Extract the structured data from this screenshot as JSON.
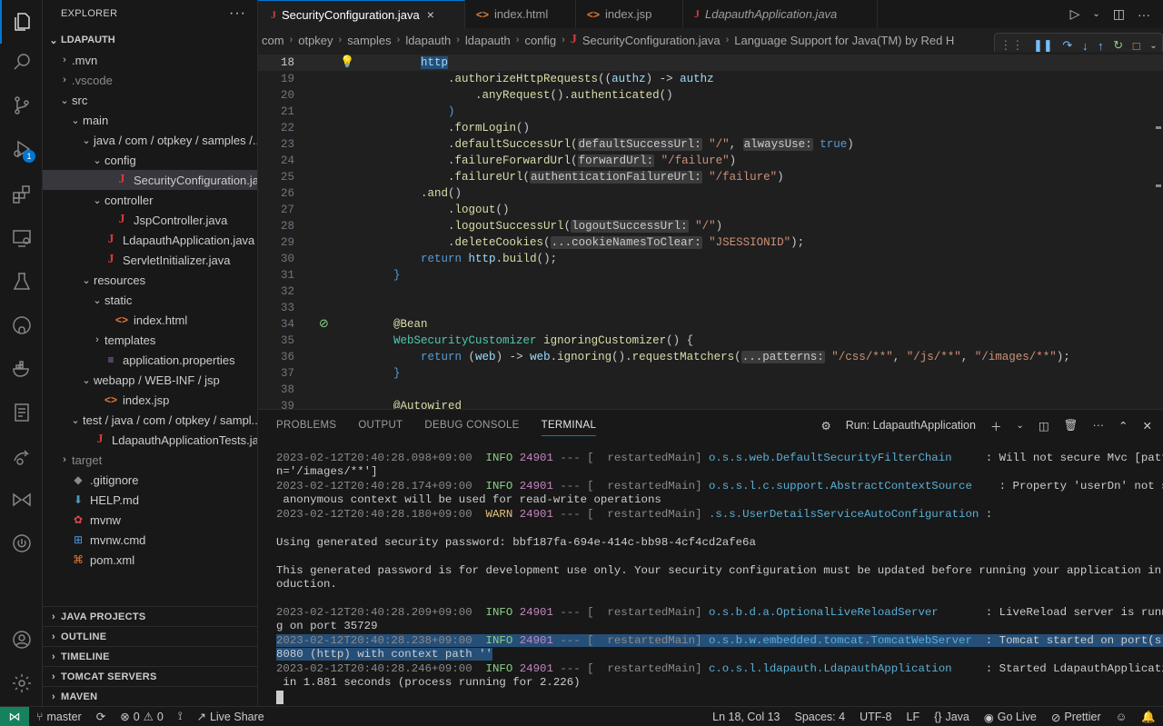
{
  "sidebar": {
    "title": "EXPLORER",
    "more": "···",
    "root": "LDAPAUTH",
    "tree": [
      {
        "depth": 1,
        "chev": "›",
        "icon": "",
        "label": ".mvn",
        "dim": false
      },
      {
        "depth": 1,
        "chev": "›",
        "icon": "",
        "label": ".vscode",
        "dim": true
      },
      {
        "depth": 1,
        "chev": "⌄",
        "icon": "",
        "label": "src",
        "dim": false
      },
      {
        "depth": 2,
        "chev": "⌄",
        "icon": "",
        "label": "main",
        "dim": false
      },
      {
        "depth": 3,
        "chev": "⌄",
        "icon": "",
        "label": "java / com / otpkey / samples /...",
        "dim": false
      },
      {
        "depth": 4,
        "chev": "⌄",
        "icon": "",
        "label": "config",
        "dim": false
      },
      {
        "depth": 5,
        "chev": "",
        "icon": "J",
        "label": "SecurityConfiguration.java",
        "dim": false,
        "selected": true
      },
      {
        "depth": 4,
        "chev": "⌄",
        "icon": "",
        "label": "controller",
        "dim": false
      },
      {
        "depth": 5,
        "chev": "",
        "icon": "J",
        "label": "JspController.java",
        "dim": false
      },
      {
        "depth": 4,
        "chev": "",
        "icon": "J",
        "label": "LdapauthApplication.java",
        "dim": false
      },
      {
        "depth": 4,
        "chev": "",
        "icon": "J",
        "label": "ServletInitializer.java",
        "dim": false
      },
      {
        "depth": 3,
        "chev": "⌄",
        "icon": "",
        "label": "resources",
        "dim": false
      },
      {
        "depth": 4,
        "chev": "⌄",
        "icon": "",
        "label": "static",
        "dim": false
      },
      {
        "depth": 5,
        "chev": "",
        "icon": "<>",
        "label": "index.html",
        "dim": false
      },
      {
        "depth": 4,
        "chev": "›",
        "icon": "",
        "label": "templates",
        "dim": false
      },
      {
        "depth": 4,
        "chev": "",
        "icon": "≡",
        "label": "application.properties",
        "dim": false
      },
      {
        "depth": 3,
        "chev": "⌄",
        "icon": "",
        "label": "webapp / WEB-INF / jsp",
        "dim": false
      },
      {
        "depth": 4,
        "chev": "",
        "icon": "<>",
        "label": "index.jsp",
        "dim": false
      },
      {
        "depth": 2,
        "chev": "⌄",
        "icon": "",
        "label": "test / java / com / otpkey / sampl...",
        "dim": false
      },
      {
        "depth": 3,
        "chev": "",
        "icon": "J",
        "label": "LdapauthApplicationTests.java",
        "dim": false
      },
      {
        "depth": 1,
        "chev": "›",
        "icon": "",
        "label": "target",
        "dim": true
      },
      {
        "depth": 1,
        "chev": "",
        "icon": "◆",
        "label": ".gitignore",
        "dim": false
      },
      {
        "depth": 1,
        "chev": "",
        "icon": "⬇",
        "label": "HELP.md",
        "dim": false
      },
      {
        "depth": 1,
        "chev": "",
        "icon": "✿",
        "label": "mvnw",
        "dim": false
      },
      {
        "depth": 1,
        "chev": "",
        "icon": "⊞",
        "label": "mvnw.cmd",
        "dim": false
      },
      {
        "depth": 1,
        "chev": "",
        "icon": "⌘",
        "label": "pom.xml",
        "dim": false
      }
    ],
    "sections": [
      "JAVA PROJECTS",
      "OUTLINE",
      "TIMELINE",
      "TOMCAT SERVERS",
      "MAVEN"
    ]
  },
  "tabs": [
    {
      "label": "SecurityConfiguration.java",
      "icon": "J",
      "active": true,
      "close": "×"
    },
    {
      "label": "index.html",
      "icon": "<>",
      "active": false
    },
    {
      "label": "index.jsp",
      "icon": "<>",
      "active": false
    },
    {
      "label": "LdapauthApplication.java",
      "icon": "J",
      "active": false,
      "italic": true
    }
  ],
  "breadcrumb": [
    "com",
    "otpkey",
    "samples",
    "ldapauth",
    "ldapauth",
    "config",
    "SecurityConfiguration.java",
    "Language Support for Java(TM) by Red H"
  ],
  "editor": {
    "lines": [
      {
        "n": "18",
        "current": true,
        "glyph": "bulb",
        "code": [
          [
            "        ",
            "p"
          ],
          [
            "http",
            "v hl"
          ]
        ]
      },
      {
        "n": "19",
        "code": [
          [
            "            .",
            "p"
          ],
          [
            "authorizeHttpRequests",
            "m"
          ],
          [
            "((",
            "p"
          ],
          [
            "authz",
            "v"
          ],
          [
            ") -> ",
            "p"
          ],
          [
            "authz",
            "v"
          ]
        ]
      },
      {
        "n": "20",
        "code": [
          [
            "                .",
            "p"
          ],
          [
            "anyRequest",
            "m"
          ],
          [
            "().",
            "p"
          ],
          [
            "authenticated",
            "m"
          ],
          [
            "()",
            "p"
          ]
        ]
      },
      {
        "n": "21",
        "code": [
          [
            "            )",
            "k"
          ]
        ]
      },
      {
        "n": "22",
        "code": [
          [
            "            .",
            "p"
          ],
          [
            "formLogin",
            "m"
          ],
          [
            "()",
            "p"
          ]
        ]
      },
      {
        "n": "23",
        "code": [
          [
            "            .",
            "p"
          ],
          [
            "defaultSuccessUrl",
            "m"
          ],
          [
            "(",
            "p"
          ],
          [
            "defaultSuccessUrl:",
            "ph"
          ],
          [
            " ",
            "p"
          ],
          [
            "\"/\"",
            "s"
          ],
          [
            ", ",
            "p"
          ],
          [
            "alwaysUse:",
            "ph"
          ],
          [
            " ",
            "p"
          ],
          [
            "true",
            "k"
          ],
          [
            ")",
            "p"
          ]
        ]
      },
      {
        "n": "24",
        "code": [
          [
            "            .",
            "p"
          ],
          [
            "failureForwardUrl",
            "m"
          ],
          [
            "(",
            "p"
          ],
          [
            "forwardUrl:",
            "ph"
          ],
          [
            " ",
            "p"
          ],
          [
            "\"/failure\"",
            "s"
          ],
          [
            ")",
            "p"
          ]
        ]
      },
      {
        "n": "25",
        "code": [
          [
            "            .",
            "p"
          ],
          [
            "failureUrl",
            "m"
          ],
          [
            "(",
            "p"
          ],
          [
            "authenticationFailureUrl:",
            "ph"
          ],
          [
            " ",
            "p"
          ],
          [
            "\"/failure\"",
            "s"
          ],
          [
            ")",
            "p"
          ]
        ]
      },
      {
        "n": "26",
        "code": [
          [
            "        .",
            "p"
          ],
          [
            "and",
            "m"
          ],
          [
            "()",
            "p"
          ]
        ]
      },
      {
        "n": "27",
        "code": [
          [
            "            .",
            "p"
          ],
          [
            "logout",
            "m"
          ],
          [
            "()",
            "p"
          ]
        ]
      },
      {
        "n": "28",
        "code": [
          [
            "            .",
            "p"
          ],
          [
            "logoutSuccessUrl",
            "m"
          ],
          [
            "(",
            "p"
          ],
          [
            "logoutSuccessUrl:",
            "ph"
          ],
          [
            " ",
            "p"
          ],
          [
            "\"/\"",
            "s"
          ],
          [
            ")",
            "p"
          ]
        ]
      },
      {
        "n": "29",
        "code": [
          [
            "            .",
            "p"
          ],
          [
            "deleteCookies",
            "m"
          ],
          [
            "(",
            "p"
          ],
          [
            "...cookieNamesToClear:",
            "ph"
          ],
          [
            " ",
            "p"
          ],
          [
            "\"JSESSIONID\"",
            "s"
          ],
          [
            ");",
            "p"
          ]
        ]
      },
      {
        "n": "30",
        "code": [
          [
            "        ",
            "p"
          ],
          [
            "return",
            "k"
          ],
          [
            " ",
            "p"
          ],
          [
            "http",
            "v"
          ],
          [
            ".",
            "p"
          ],
          [
            "build",
            "m"
          ],
          [
            "();",
            "p"
          ]
        ]
      },
      {
        "n": "31",
        "code": [
          [
            "    }",
            "k"
          ]
        ]
      },
      {
        "n": "32",
        "code": []
      },
      {
        "n": "33",
        "code": []
      },
      {
        "n": "34",
        "glyph": "noentry",
        "code": [
          [
            "    ",
            "p"
          ],
          [
            "@Bean",
            "a"
          ]
        ]
      },
      {
        "n": "35",
        "code": [
          [
            "    ",
            "p"
          ],
          [
            "WebSecurityCustomizer",
            "t"
          ],
          [
            " ",
            "p"
          ],
          [
            "ignoringCustomizer",
            "m"
          ],
          [
            "() {",
            "p"
          ]
        ]
      },
      {
        "n": "36",
        "code": [
          [
            "        ",
            "p"
          ],
          [
            "return",
            "k"
          ],
          [
            " (",
            "p"
          ],
          [
            "web",
            "v"
          ],
          [
            ") -> ",
            "p"
          ],
          [
            "web",
            "v"
          ],
          [
            ".",
            "p"
          ],
          [
            "ignoring",
            "m"
          ],
          [
            "().",
            "p"
          ],
          [
            "requestMatchers",
            "m"
          ],
          [
            "(",
            "p"
          ],
          [
            "...patterns:",
            "ph"
          ],
          [
            " ",
            "p"
          ],
          [
            "\"/css/**\"",
            "s"
          ],
          [
            ", ",
            "p"
          ],
          [
            "\"/js/**\"",
            "s"
          ],
          [
            ", ",
            "p"
          ],
          [
            "\"/images/**\"",
            "s"
          ],
          [
            ");",
            "p"
          ]
        ]
      },
      {
        "n": "37",
        "code": [
          [
            "    }",
            "k"
          ]
        ]
      },
      {
        "n": "38",
        "code": []
      },
      {
        "n": "39",
        "code": [
          [
            "    ",
            "p"
          ],
          [
            "@Autowired",
            "a"
          ]
        ]
      }
    ]
  },
  "panel": {
    "tabs": [
      "PROBLEMS",
      "OUTPUT",
      "DEBUG CONSOLE",
      "TERMINAL"
    ],
    "active_tab": "TERMINAL",
    "run_label": "Run: LdapauthApplication",
    "terminal": [
      {
        "segs": [
          [
            "2023-02-12T20:40:28.098+09:00  ",
            "ts"
          ],
          [
            "INFO",
            "tinfo"
          ],
          [
            " ",
            "p"
          ],
          [
            "24901",
            "tpid"
          ],
          [
            " --- [  ",
            "tdash"
          ],
          [
            "restartedMain",
            "ts"
          ],
          [
            "] ",
            "tdash"
          ],
          [
            "o.s.s.web.DefaultSecurityFilterChain",
            "tlog"
          ],
          [
            "     : Will not secure Mvc [patter",
            "p"
          ]
        ]
      },
      {
        "segs": [
          [
            "n='/images/**']",
            "p"
          ]
        ]
      },
      {
        "segs": [
          [
            "2023-02-12T20:40:28.174+09:00  ",
            "ts"
          ],
          [
            "INFO",
            "tinfo"
          ],
          [
            " ",
            "p"
          ],
          [
            "24901",
            "tpid"
          ],
          [
            " --- [  ",
            "tdash"
          ],
          [
            "restartedMain",
            "ts"
          ],
          [
            "] ",
            "tdash"
          ],
          [
            "o.s.s.l.c.support.AbstractContextSource",
            "tlog"
          ],
          [
            "    : Property 'userDn' not set -",
            "p"
          ]
        ]
      },
      {
        "segs": [
          [
            " anonymous context will be used for read-write operations",
            "p"
          ]
        ]
      },
      {
        "segs": [
          [
            "2023-02-12T20:40:28.180+09:00  ",
            "ts"
          ],
          [
            "WARN",
            "twarn"
          ],
          [
            " ",
            "p"
          ],
          [
            "24901",
            "tpid"
          ],
          [
            " --- [  ",
            "tdash"
          ],
          [
            "restartedMain",
            "ts"
          ],
          [
            "] ",
            "tdash"
          ],
          [
            ".s.s.UserDetailsServiceAutoConfiguration",
            "tlog"
          ],
          [
            " :",
            "p"
          ]
        ]
      },
      {
        "segs": []
      },
      {
        "segs": [
          [
            "Using generated security password: bbf187fa-694e-414c-bb98-4cf4cd2afe6a",
            "p"
          ]
        ]
      },
      {
        "segs": []
      },
      {
        "segs": [
          [
            "This generated password is for development use only. Your security configuration must be updated before running your application in pr",
            "p"
          ]
        ]
      },
      {
        "segs": [
          [
            "oduction.",
            "p"
          ]
        ]
      },
      {
        "segs": []
      },
      {
        "segs": [
          [
            "2023-02-12T20:40:28.209+09:00  ",
            "ts"
          ],
          [
            "INFO",
            "tinfo"
          ],
          [
            " ",
            "p"
          ],
          [
            "24901",
            "tpid"
          ],
          [
            " --- [  ",
            "tdash"
          ],
          [
            "restartedMain",
            "ts"
          ],
          [
            "] ",
            "tdash"
          ],
          [
            "o.s.b.d.a.OptionalLiveReloadServer",
            "tlog"
          ],
          [
            "       : LiveReload server is runnin",
            "p"
          ]
        ]
      },
      {
        "segs": [
          [
            "g on port 35729",
            "p"
          ]
        ]
      },
      {
        "selected": true,
        "segs": [
          [
            "2023-02-12T20:40:28.238+09:00  ",
            "ts"
          ],
          [
            "INFO",
            "tinfo"
          ],
          [
            " ",
            "p"
          ],
          [
            "24901",
            "tpid"
          ],
          [
            " --- [  ",
            "tdash"
          ],
          [
            "restartedMain",
            "ts"
          ],
          [
            "] ",
            "tdash"
          ],
          [
            "o.s.b.w.embedded.tomcat.TomcatWebServer",
            "tlog"
          ],
          [
            "  : Tomcat started on port(s):",
            "p"
          ]
        ]
      },
      {
        "selected": true,
        "segs": [
          [
            "8080 (http) with context path ''",
            "p"
          ]
        ]
      },
      {
        "segs": [
          [
            "2023-02-12T20:40:28.246+09:00  ",
            "ts"
          ],
          [
            "INFO",
            "tinfo"
          ],
          [
            " ",
            "p"
          ],
          [
            "24901",
            "tpid"
          ],
          [
            " --- [  ",
            "tdash"
          ],
          [
            "restartedMain",
            "ts"
          ],
          [
            "] ",
            "tdash"
          ],
          [
            "c.o.s.l.ldapauth.LdapauthApplication",
            "tlog"
          ],
          [
            "     : Started LdapauthApplication",
            "p"
          ]
        ]
      },
      {
        "segs": [
          [
            " in 1.881 seconds (process running for 2.226)",
            "p"
          ]
        ]
      }
    ]
  },
  "status": {
    "branch": "master",
    "sync": "⟳",
    "errors": "0",
    "warnings": "0",
    "live_share": "Live Share",
    "position": "Ln 18, Col 13",
    "spaces": "Spaces: 4",
    "encoding": "UTF-8",
    "eol": "LF",
    "language": "Java",
    "language_icon": "{}",
    "go_live": "Go Live",
    "prettier": "Prettier"
  },
  "activity": {
    "debug_badge": "1"
  },
  "colors": {
    "accent": "#0078d4",
    "remote": "#16825d",
    "selection": "#264f78"
  }
}
